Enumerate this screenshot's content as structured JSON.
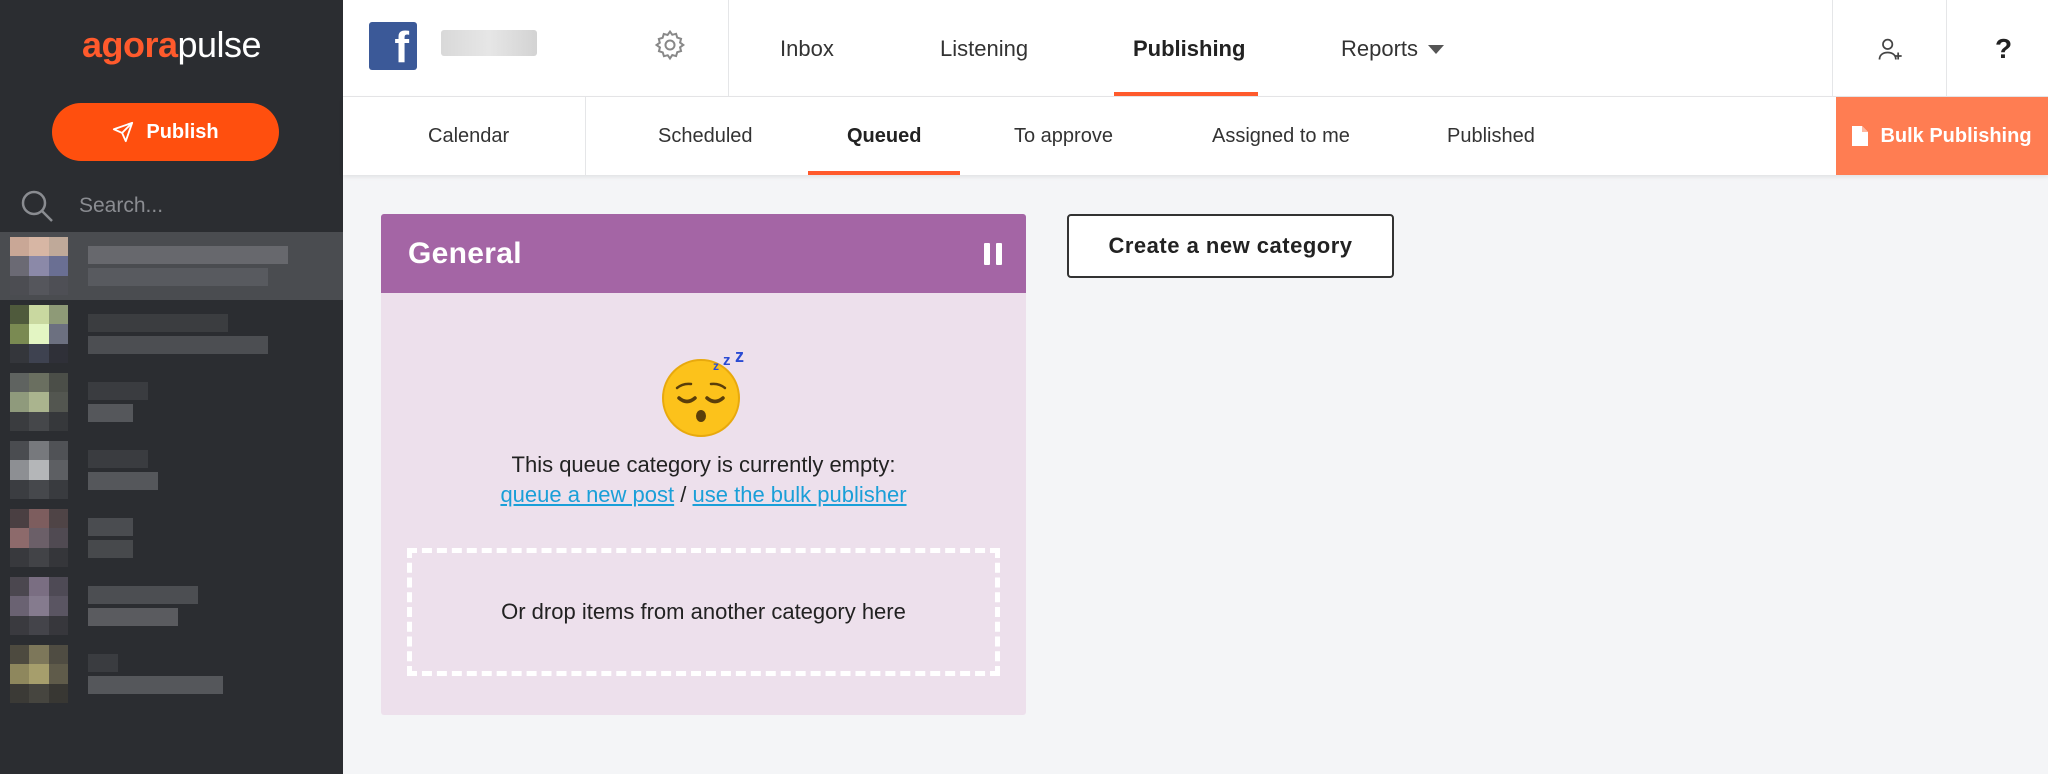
{
  "app": {
    "logo_part1": "agora",
    "logo_part2": "pulse"
  },
  "sidebar": {
    "publish_label": "Publish",
    "search_placeholder": "Search..."
  },
  "topbar": {
    "nav": [
      {
        "label": "Inbox"
      },
      {
        "label": "Listening"
      },
      {
        "label": "Publishing",
        "active": true
      },
      {
        "label": "Reports"
      }
    ],
    "help_label": "?"
  },
  "subnav": {
    "items": [
      {
        "label": "Calendar"
      },
      {
        "label": "Scheduled"
      },
      {
        "label": "Queued",
        "active": true
      },
      {
        "label": "To approve"
      },
      {
        "label": "Assigned to me"
      },
      {
        "label": "Published"
      }
    ],
    "bulk_label": "Bulk Publishing"
  },
  "queue": {
    "category_title": "General",
    "empty_message": "This queue category is currently empty:",
    "link_queue_post": "queue a new post",
    "link_separator": "/",
    "link_bulk": "use the bulk publisher",
    "drop_text": "Or drop items from another category here"
  },
  "actions": {
    "create_category_label": "Create a new category"
  },
  "colors": {
    "brand_orange": "#ff4f0e",
    "category_purple": "#a465a5",
    "link_blue": "#1a9fd8"
  }
}
